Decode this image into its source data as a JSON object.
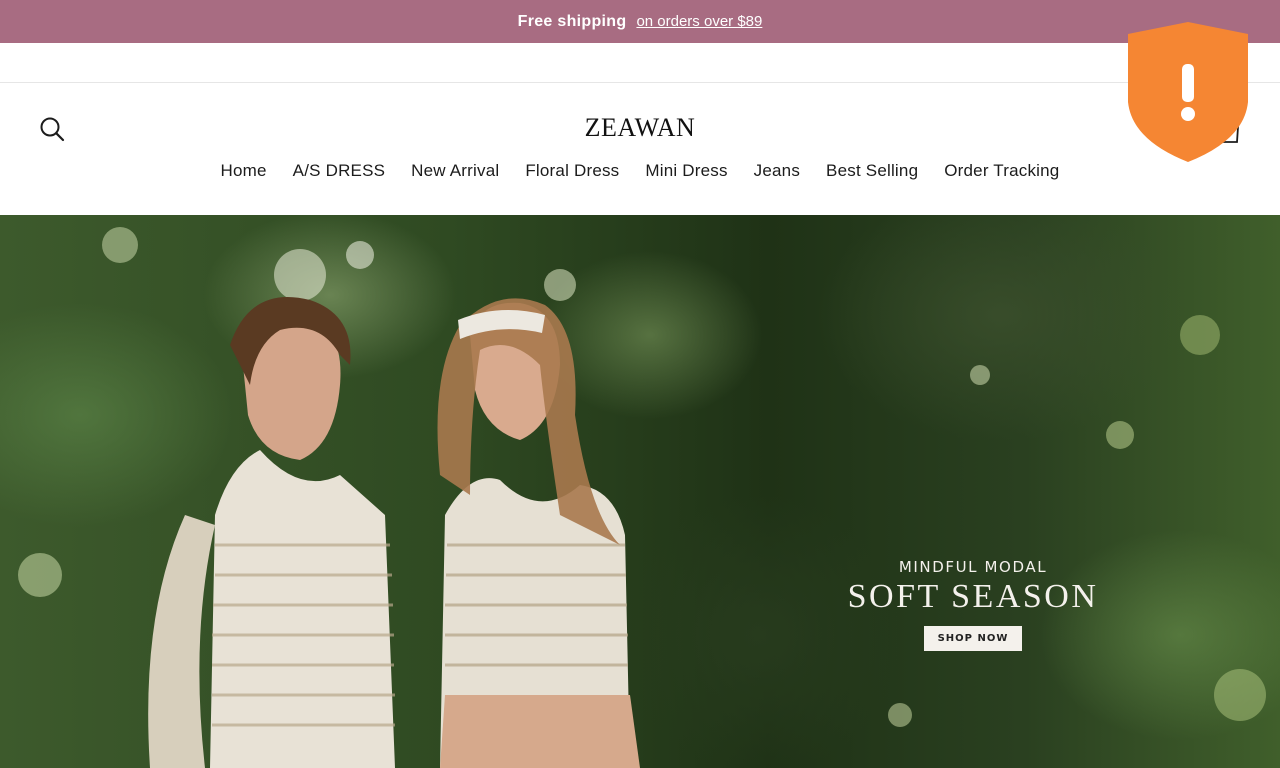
{
  "announcement": {
    "strong_text": "Free shipping",
    "link_text": "on orders over $89"
  },
  "header": {
    "logo": "ZEAWAN",
    "search_icon": "search-icon",
    "cart_icon": "cart-icon"
  },
  "nav": {
    "items": [
      {
        "label": "Home"
      },
      {
        "label": "A/S DRESS"
      },
      {
        "label": "New Arrival"
      },
      {
        "label": "Floral Dress"
      },
      {
        "label": "Mini Dress"
      },
      {
        "label": "Jeans"
      },
      {
        "label": "Best Selling"
      },
      {
        "label": "Order Tracking"
      }
    ]
  },
  "hero": {
    "eyebrow": "MINDFUL MODAL",
    "title": "SOFT SEASON",
    "cta": "SHOP NOW"
  },
  "badge": {
    "icon": "warning-shield-icon",
    "symbol": "!",
    "color": "#f58633"
  },
  "colors": {
    "announcement_bg": "#a86c82",
    "text": "#1c1c1c"
  }
}
